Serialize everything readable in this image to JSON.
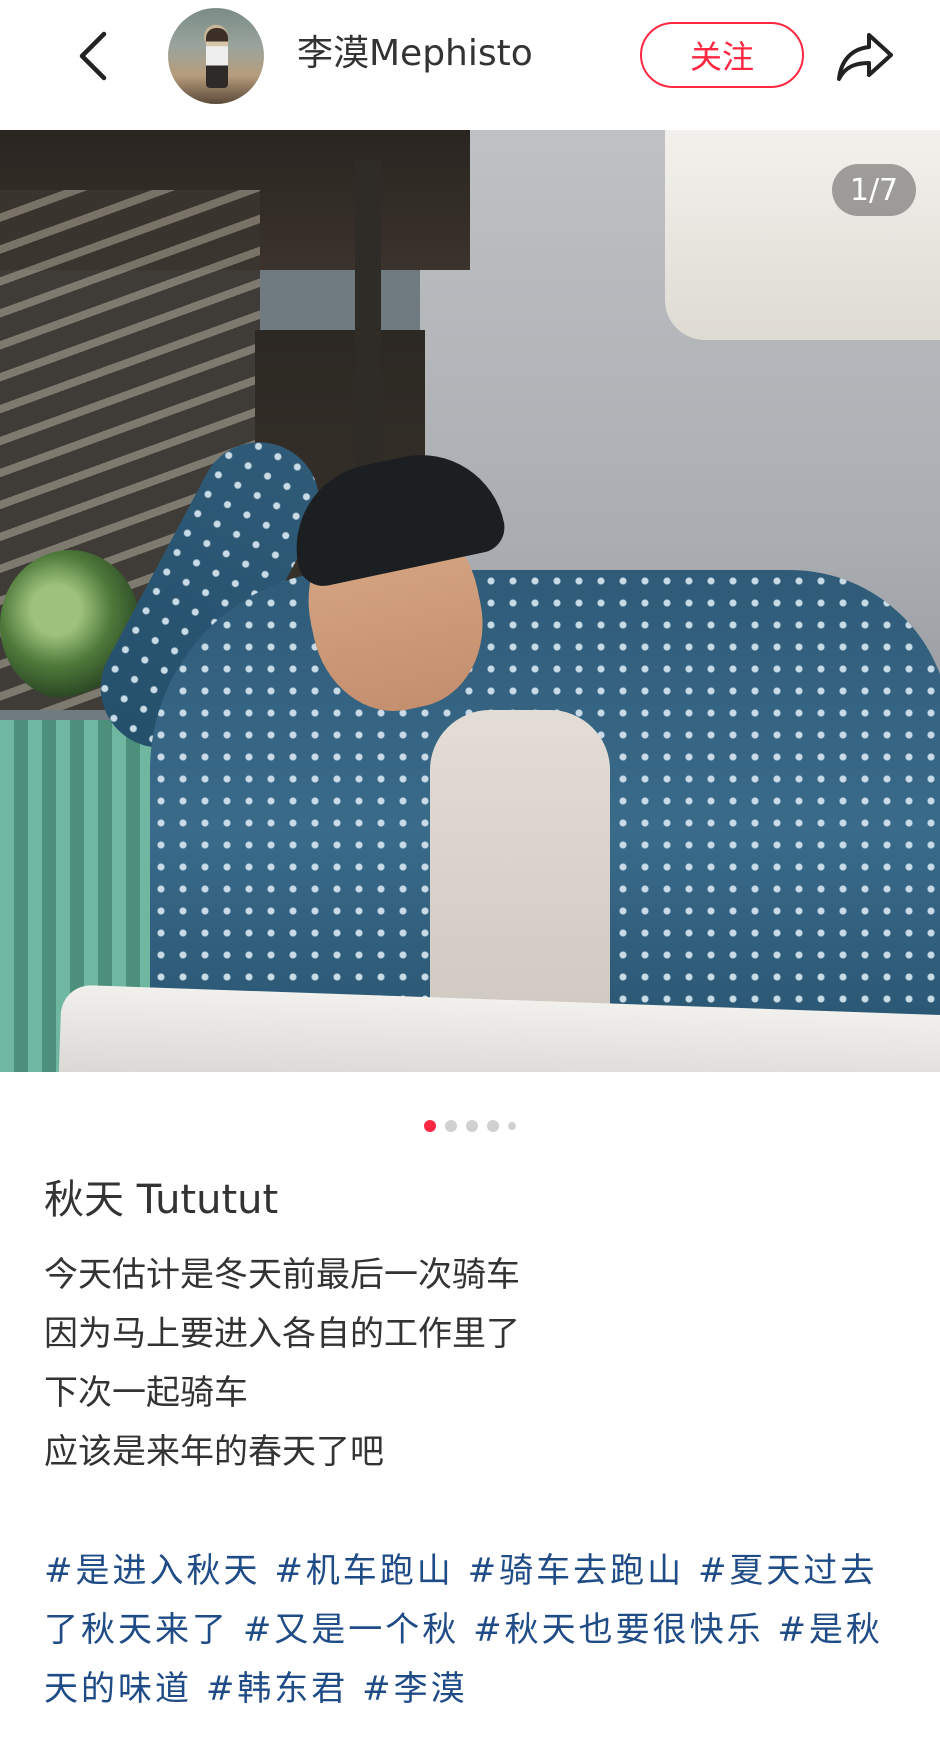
{
  "header": {
    "username": "李漠Mephisto",
    "follow_label": "关注",
    "back_icon": "chevron-left-icon",
    "share_icon": "share-arrow-icon"
  },
  "photo": {
    "counter": "1/7",
    "dots_total": 5,
    "dots_active": 0
  },
  "post": {
    "title": "秋天 Tututut",
    "lines": [
      "今天估计是冬天前最后一次骑车",
      "因为马上要进入各自的工作里了",
      "下次一起骑车",
      "应该是来年的春天了吧"
    ],
    "tags": [
      "#是进入秋天",
      "#机车跑山",
      "#骑车去跑山",
      "#夏天过去了秋天来了",
      "#又是一个秋",
      "#秋天也要很快乐",
      "#是秋天的味道",
      "#韩东君",
      "#李漠"
    ]
  },
  "colors": {
    "accent": "#ff2741",
    "tag": "#1f4b86"
  }
}
